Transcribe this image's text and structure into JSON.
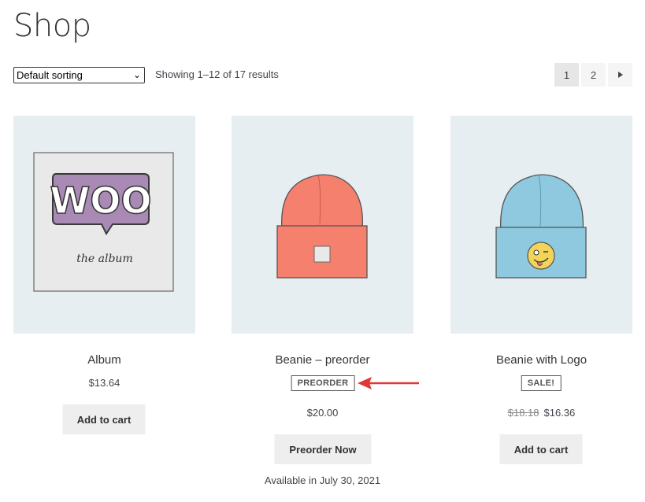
{
  "page": {
    "title": "Shop"
  },
  "toolbar": {
    "sorting_selected": "Default sorting",
    "results_text": "Showing 1–12 of 17 results"
  },
  "pagination": {
    "pages": [
      "1",
      "2"
    ],
    "current": "1",
    "next_icon": "triangle-right-icon"
  },
  "products": [
    {
      "name": "Album",
      "price": "$13.64",
      "button": "Add to cart"
    },
    {
      "name": "Beanie – preorder",
      "badge": "PREORDER",
      "price": "$20.00",
      "button": "Preorder Now",
      "availability": "Available in July 30, 2021"
    },
    {
      "name": "Beanie with Logo",
      "badge": "SALE!",
      "old_price": "$18.18",
      "price": "$16.36",
      "button": "Add to cart"
    }
  ],
  "images": {
    "album": {
      "cover_text": "WOO",
      "subtitle": "the album"
    }
  },
  "colors": {
    "thumb_bg": "#e7eef2",
    "woo_purple": "#a98ab5",
    "beanie_orange": "#f5806d",
    "beanie_blue": "#8ec9df",
    "annotation_red": "#e33535"
  }
}
